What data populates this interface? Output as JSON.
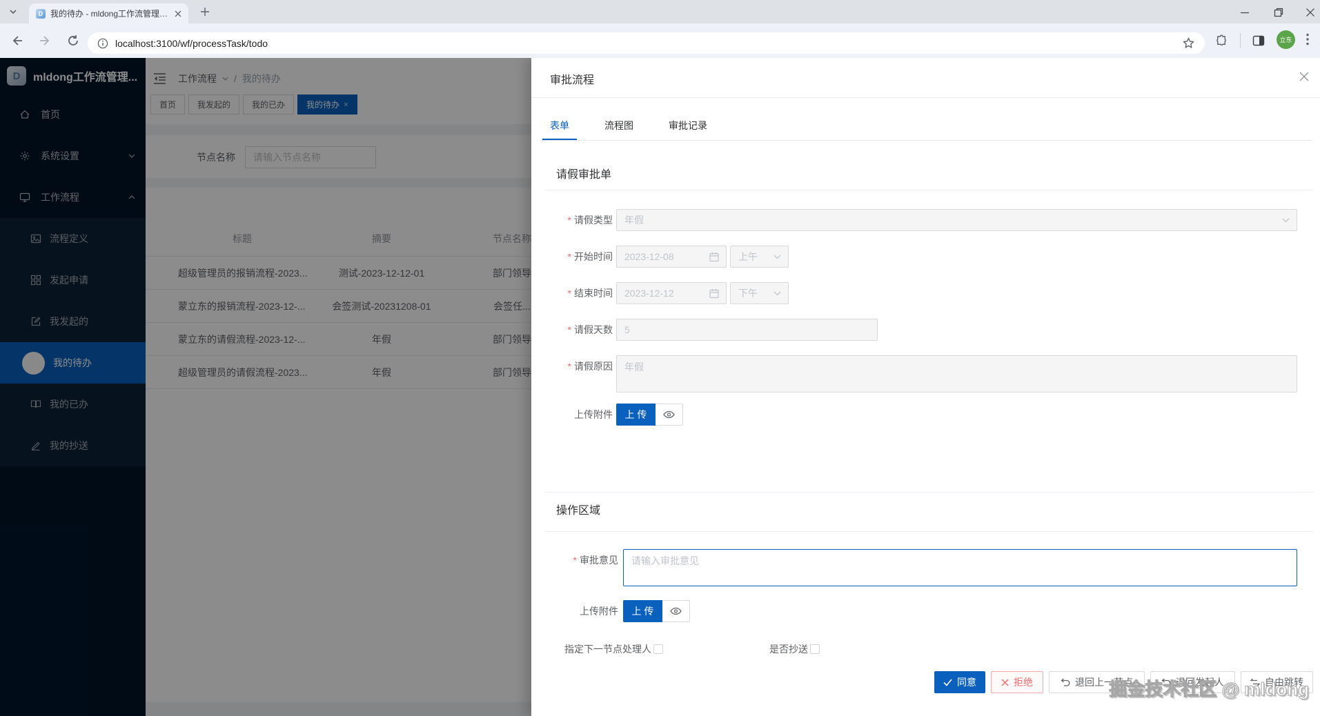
{
  "browser": {
    "tab_title": "我的待办 - mldong工作流管理…",
    "url": "localhost:3100/wf/processTask/todo",
    "avatar_text": "立东"
  },
  "sidebar": {
    "logo_title": "mldong工作流管理...",
    "items": [
      {
        "label": "首页"
      },
      {
        "label": "系统设置"
      },
      {
        "label": "工作流程"
      }
    ],
    "sub_items": [
      {
        "label": "流程定义"
      },
      {
        "label": "发起申请"
      },
      {
        "label": "我发起的"
      },
      {
        "label": "我的待办"
      },
      {
        "label": "我的已办"
      },
      {
        "label": "我的抄送"
      }
    ]
  },
  "header": {
    "breadcrumb": [
      "工作流程",
      "我的待办"
    ],
    "breadcrumb_sep": "/"
  },
  "tabs": [
    {
      "label": "首页"
    },
    {
      "label": "我发起的"
    },
    {
      "label": "我的已办"
    },
    {
      "label": "我的待办"
    }
  ],
  "search": {
    "label": "节点名称",
    "placeholder": "请输入节点名称"
  },
  "table": {
    "columns": [
      "标题",
      "摘要",
      "节点名称"
    ],
    "rows": [
      {
        "title": "超级管理员的报销流程-2023...",
        "summary": "测试-2023-12-12-01",
        "node": "部门领导"
      },
      {
        "title": "蒙立东的报销流程-2023-12-...",
        "summary": "会签测试-20231208-01",
        "node": "会签任..."
      },
      {
        "title": "蒙立东的请假流程-2023-12-...",
        "summary": "年假",
        "node": "部门领导"
      },
      {
        "title": "超级管理员的请假流程-2023...",
        "summary": "年假",
        "node": "部门领导"
      }
    ]
  },
  "drawer": {
    "title": "审批流程",
    "tabs": [
      {
        "label": "表单"
      },
      {
        "label": "流程图"
      },
      {
        "label": "审批记录"
      }
    ],
    "form_title": "请假审批单",
    "form": {
      "leave_type": {
        "label": "请假类型",
        "value": "年假"
      },
      "start_time": {
        "label": "开始时间",
        "date": "2023-12-08",
        "period": "上午"
      },
      "end_time": {
        "label": "结束时间",
        "date": "2023-12-12",
        "period": "下午"
      },
      "days": {
        "label": "请假天数",
        "value": "5"
      },
      "reason": {
        "label": "请假原因",
        "value": "年假"
      },
      "upload": {
        "label": "上传附件",
        "button": "上 传"
      }
    },
    "action_title": "操作区域",
    "action": {
      "opinion": {
        "label": "审批意见",
        "placeholder": "请输入审批意见"
      },
      "upload": {
        "label": "上传附件",
        "button": "上 传"
      },
      "assign_next": {
        "label": "指定下一节点处理人"
      },
      "copy_to": {
        "label": "是否抄送"
      }
    },
    "footer_buttons": [
      {
        "label": "同意"
      },
      {
        "label": "拒绝"
      },
      {
        "label": "退回上一节点"
      },
      {
        "label": "退回发起人"
      },
      {
        "label": "自由跳转"
      }
    ]
  },
  "watermark": "掘金技术社区 @ mldong",
  "colors": {
    "primary": "#0960bd",
    "sidebar": "#001529",
    "danger": "#f56c6c"
  }
}
